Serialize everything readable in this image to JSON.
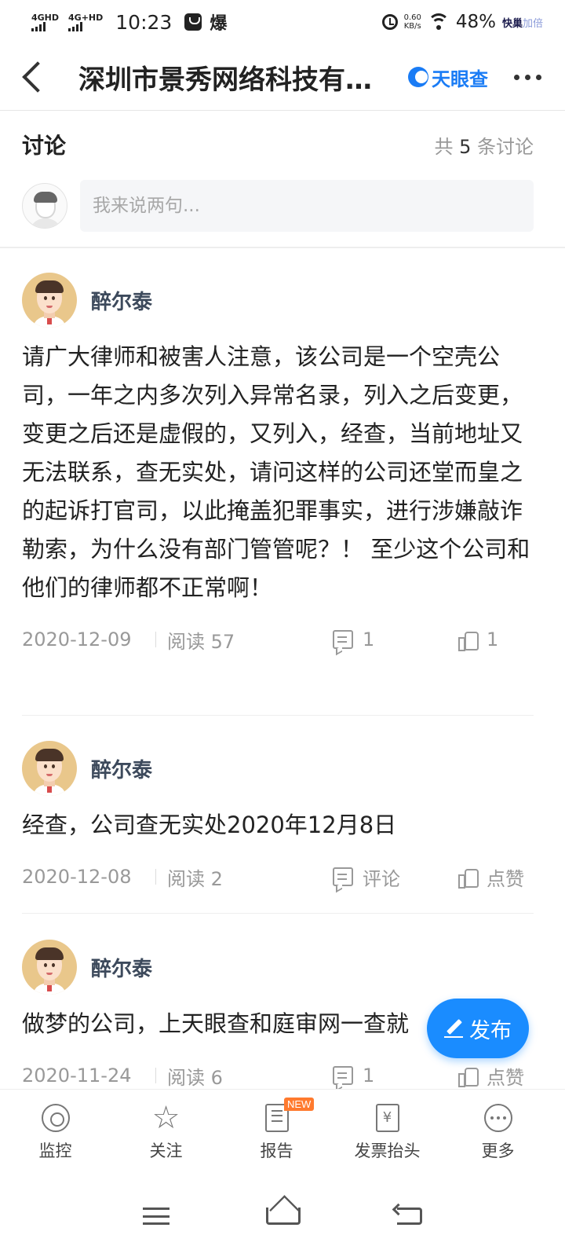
{
  "status_bar": {
    "network1": "4GHD",
    "network2": "4G+HD",
    "time": "10:23",
    "notification_app": "爆",
    "net_speed_value": "0.60",
    "net_speed_unit": "KB/s",
    "battery": "48%",
    "badge_main": "快巢",
    "badge_sub": "加倍"
  },
  "header": {
    "title": "深圳市景秀网络科技有限公司",
    "brand": "天眼查"
  },
  "discussion": {
    "title": "讨论",
    "count_prefix": "共",
    "count": "5",
    "count_suffix": "条讨论",
    "input_placeholder": "我来说两句..."
  },
  "posts": [
    {
      "user": "醉尔泰",
      "text": "请广大律师和被害人注意，该公司是一个空壳公司，一年之内多次列入异常名录，列入之后变更，变更之后还是虚假的，又列入，经查，当前地址又无法联系，查无实处，请问这样的公司还堂而皇之的起诉打官司，以此掩盖犯罪事实，进行涉嫌敲诈勒索，为什么没有部门管管呢？！ 至少这个公司和他们的律师都不正常啊！",
      "date": "2020-12-09",
      "read": "阅读 57",
      "comments": "1",
      "likes": "1"
    },
    {
      "user": "醉尔泰",
      "text": "经查，公司查无实处2020年12月8日",
      "date": "2020-12-08",
      "read": "阅读 2",
      "comments": "评论",
      "likes": "点赞"
    },
    {
      "user": "醉尔泰",
      "text": "做梦的公司，上天眼查和庭审网一查就",
      "date": "2020-11-24",
      "read": "阅读 6",
      "comments": "1",
      "likes": "点赞"
    }
  ],
  "fab": {
    "label": "发布"
  },
  "tabbar": {
    "items": [
      {
        "label": "监控",
        "icon": "monitor-icon"
      },
      {
        "label": "关注",
        "icon": "star-icon"
      },
      {
        "label": "报告",
        "icon": "report-icon",
        "badge": "NEW"
      },
      {
        "label": "发票抬头",
        "icon": "invoice-icon"
      },
      {
        "label": "更多",
        "icon": "more-icon"
      }
    ]
  },
  "colors": {
    "accent": "#1a8cff",
    "brand": "#1a7cf5",
    "badge": "#ff7a2e",
    "meta_text": "#999999"
  }
}
